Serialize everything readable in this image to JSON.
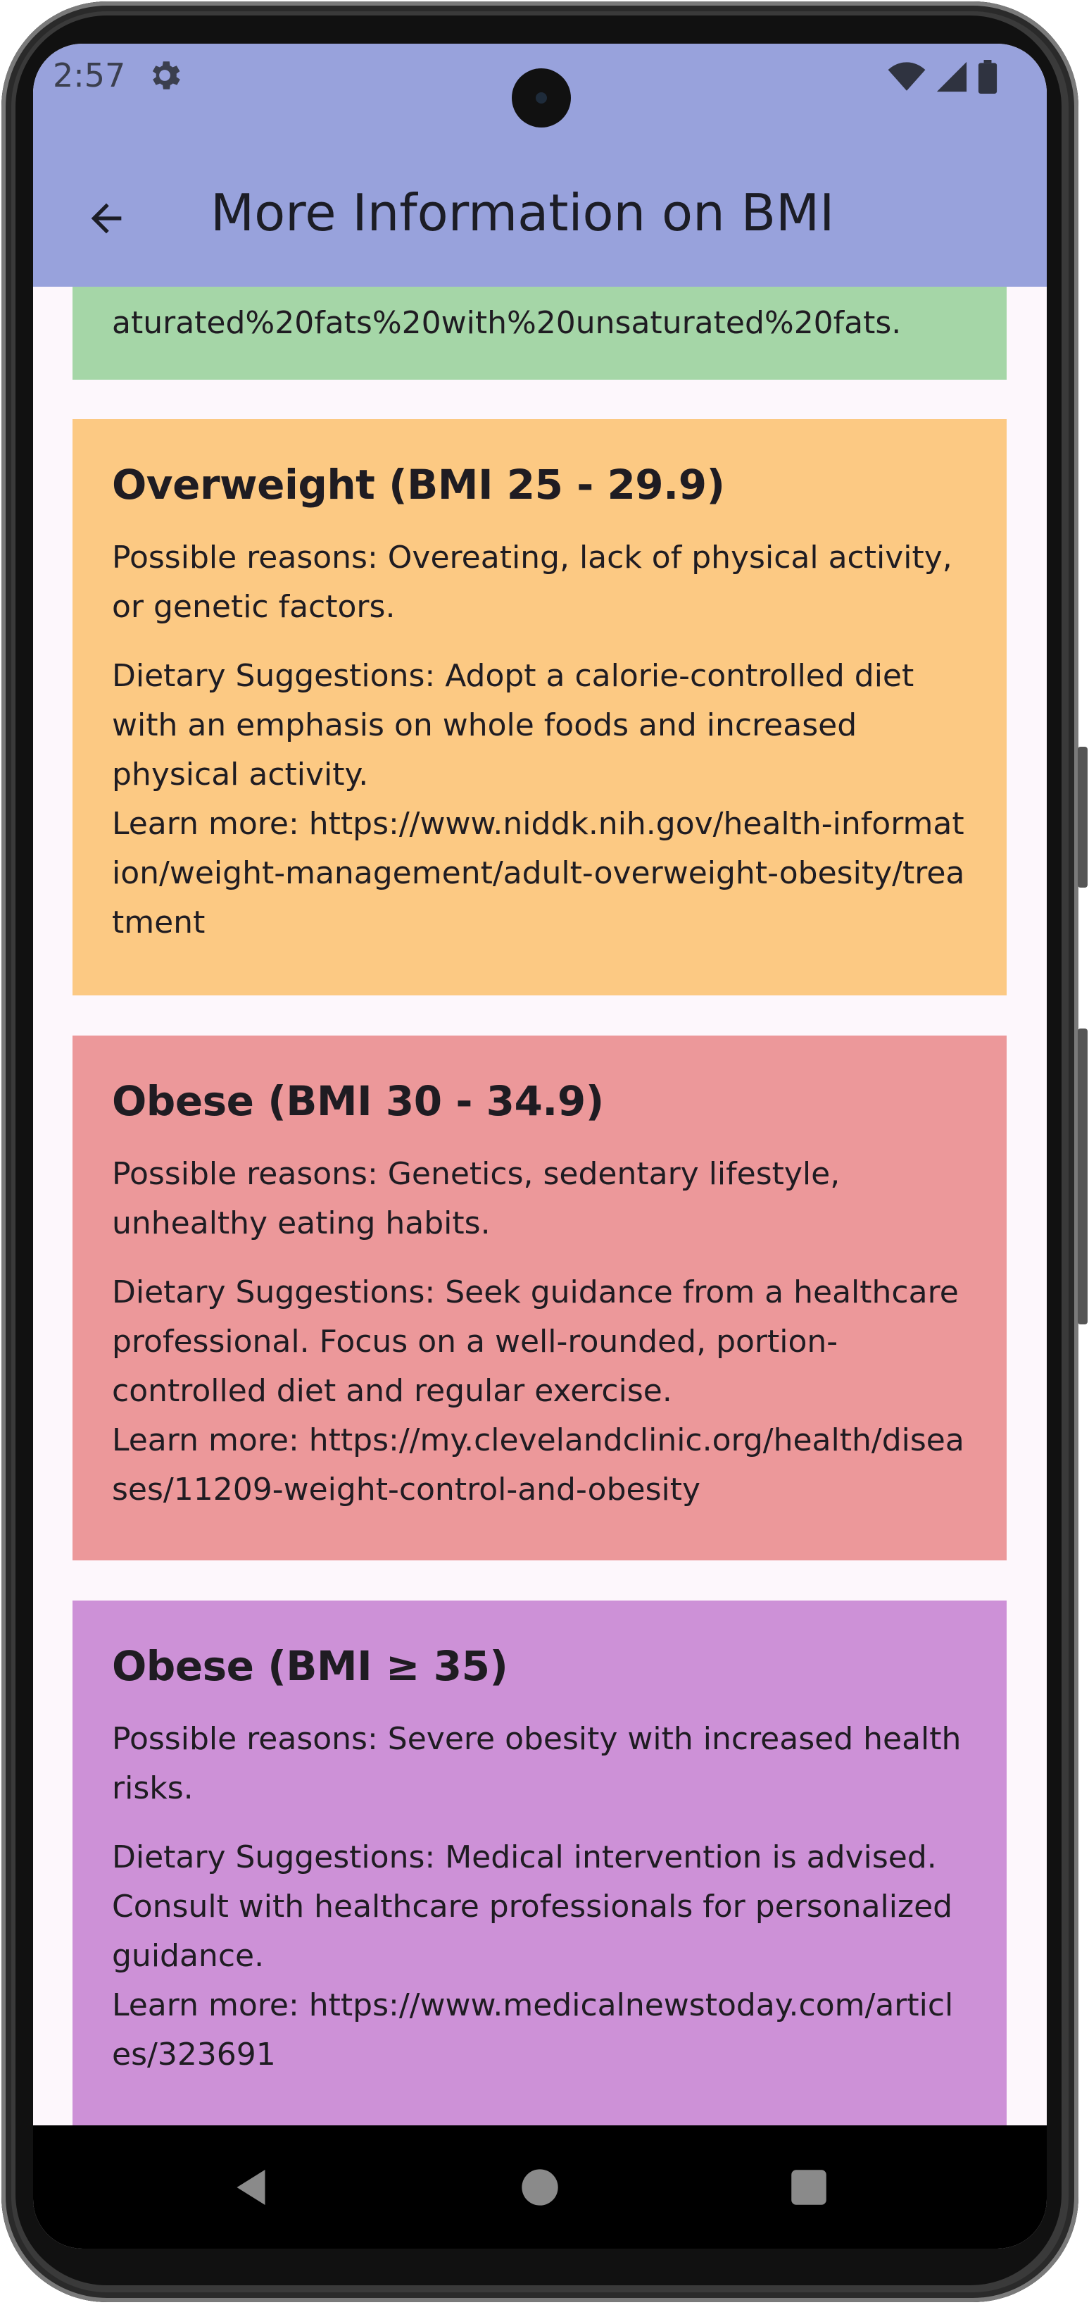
{
  "status_bar": {
    "time": "2:57",
    "icons": [
      "settings-icon",
      "wifi-icon",
      "signal-icon",
      "battery-icon"
    ]
  },
  "app_bar": {
    "title": "More Information on BMI",
    "back_icon": "arrow-back-icon"
  },
  "cards": {
    "partial_text": "aturated%20fats%20with%20unsaturated%20fats.",
    "overweight": {
      "title": "Overweight (BMI 25 - 29.9)",
      "reasons": "Possible reasons: Overeating, lack of physical activity, or genetic factors.",
      "diet": "Dietary Suggestions: Adopt a calorie-controlled diet with an emphasis on whole foods and increased physical activity.",
      "learn": "Learn more: https://www.niddk.nih.gov/health-information/weight-management/adult-overweight-obesity/treatment",
      "color": "#fcc983"
    },
    "obese1": {
      "title": "Obese (BMI 30 - 34.9)",
      "reasons": "Possible reasons: Genetics, sedentary lifestyle, unhealthy eating habits.",
      "diet": "Dietary Suggestions: Seek guidance from a healthcare professional. Focus on a well-rounded, portion-controlled diet and regular exercise.",
      "learn": "Learn more: https://my.clevelandclinic.org/health/diseases/11209-weight-control-and-obesity",
      "color": "#ec989a"
    },
    "obese2": {
      "title": "Obese (BMI ≥ 35)",
      "reasons": "Possible reasons: Severe obesity with increased health risks.",
      "diet": "Dietary Suggestions: Medical intervention is advised. Consult with healthcare professionals for personalized guidance.",
      "learn": "Learn more: https://www.medicalnewstoday.com/articles/323691",
      "color": "#cd91d7"
    },
    "partial_color": "#a5d6a7"
  },
  "nav_bar": {
    "icons": [
      "nav-back-icon",
      "nav-home-icon",
      "nav-recents-icon"
    ]
  },
  "colors": {
    "app_bar": "#98a2dc",
    "background": "#fdf7fc"
  }
}
